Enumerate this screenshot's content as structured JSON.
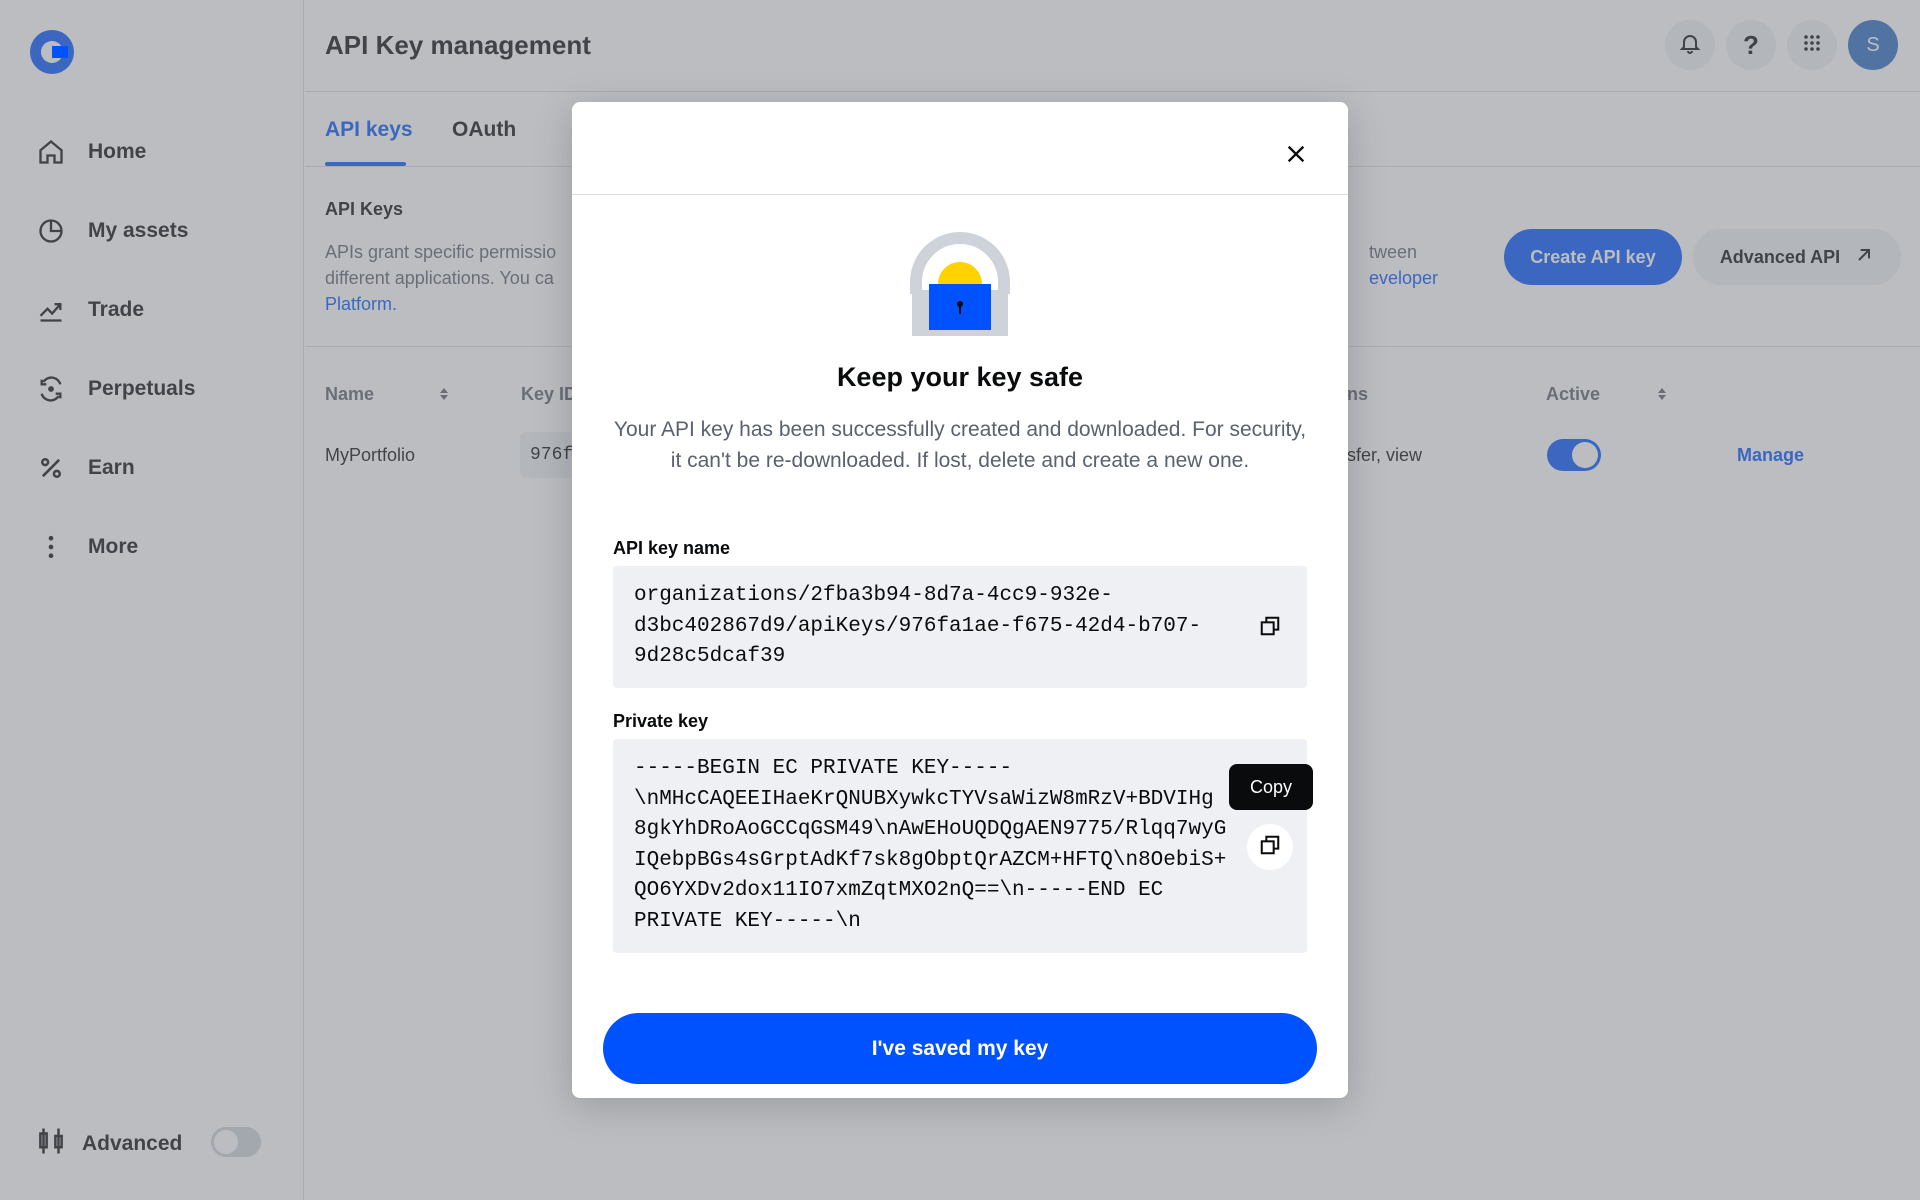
{
  "sidebar": {
    "items": [
      {
        "label": "Home",
        "icon": "home-icon"
      },
      {
        "label": "My assets",
        "icon": "pie-chart-icon"
      },
      {
        "label": "Trade",
        "icon": "trend-chart-icon"
      },
      {
        "label": "Perpetuals",
        "icon": "refresh-icon"
      },
      {
        "label": "Earn",
        "icon": "percent-icon"
      },
      {
        "label": "More",
        "icon": "more-vertical-icon"
      }
    ],
    "advanced_label": "Advanced",
    "advanced_enabled": false
  },
  "header": {
    "title": "API Key management",
    "avatar_initial": "S"
  },
  "tabs": [
    {
      "label": "API keys",
      "active": true
    },
    {
      "label": "OAuth",
      "active": false
    }
  ],
  "section": {
    "title": "API Keys",
    "desc_line1": "APIs grant specific permissio",
    "desc_line1_right": "tween",
    "desc_line2": "different applications. You ca",
    "desc_line2_right": "eveloper",
    "desc_line3": "Platform.",
    "create_button": "Create API key",
    "advanced_button": "Advanced API"
  },
  "table": {
    "headers": {
      "name": "Name",
      "key_id": "Key ID",
      "permissions": "ns",
      "active": "Active"
    },
    "rows": [
      {
        "name": "MyPortfolio",
        "key_id": "976f",
        "permissions": "sfer, view",
        "active": true,
        "manage": "Manage"
      }
    ]
  },
  "modal": {
    "title": "Keep your key safe",
    "description": "Your API key has been successfully created and downloaded. For security, it can't be re-downloaded. If lost, delete and create a new one.",
    "key_name_label": "API key name",
    "key_name_value": "organizations/2fba3b94-8d7a-4cc9-932e-\nd3bc402867d9/apiKeys/976fa1ae-f675-42d4-b707-\n9d28c5dcaf39",
    "private_key_label": "Private key",
    "private_key_value": "-----BEGIN EC PRIVATE KEY-----\n\\nMHcCAQEEIHaeKrQNUBXywkcTYVsaWizW8mRzV+BDVIHg\n8gkYhDRoAoGCCqGSM49\\nAwEHoUQDQgAEN9775/Rlqq7wyG\nIQebpBGs4sGrptAdKf7sk8gObptQrAZCM+HFTQ\\n8OebiS+\nQO6YXDv2dox11IO7xmZqtMXO2nQ==\\n-----END EC\nPRIVATE KEY-----\\n",
    "copy_tooltip": "Copy",
    "confirm_button": "I've saved my key"
  },
  "colors": {
    "brand": "#0052ff",
    "text": "#0a0b0d",
    "muted": "#5b616e",
    "field_bg": "#eef0f3",
    "lock_yellow": "#ffd200"
  }
}
